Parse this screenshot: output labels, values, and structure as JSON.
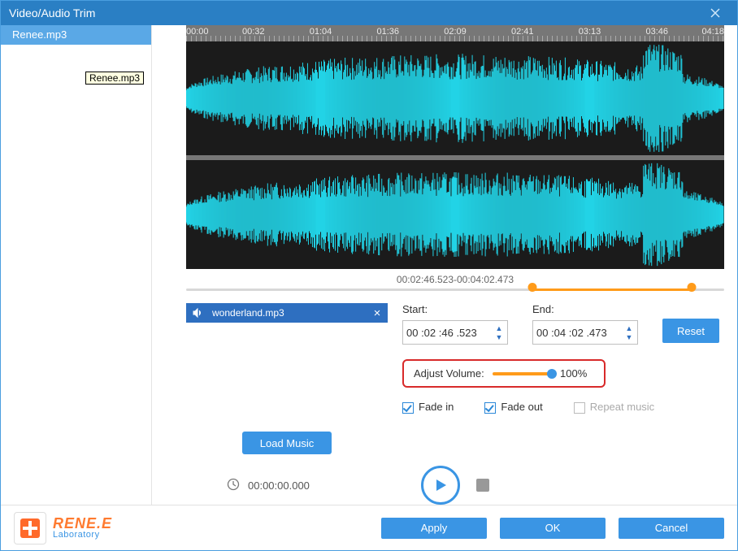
{
  "window": {
    "title": "Video/Audio Trim"
  },
  "sidebar": {
    "items": [
      {
        "label": "Renee.mp3"
      }
    ],
    "tooltip": "Renee.mp3"
  },
  "timeline": {
    "ticks": [
      "00:00",
      "00:32",
      "01:04",
      "01:36",
      "02:09",
      "02:41",
      "03:13",
      "03:46",
      "04:18"
    ]
  },
  "range": {
    "text": "00:02:46.523-00:04:02.473",
    "start_pct": 64.4,
    "end_pct": 93.9
  },
  "music": {
    "file": "wonderland.mp3"
  },
  "trim": {
    "start_label": "Start:",
    "end_label": "End:",
    "start_value": "00 :02 :46 .523",
    "end_value": "00 :04 :02 .473",
    "reset_label": "Reset"
  },
  "volume": {
    "label": "Adjust Volume:",
    "value_text": "100%"
  },
  "options": {
    "fade_in": {
      "label": "Fade in",
      "checked": true
    },
    "fade_out": {
      "label": "Fade out",
      "checked": true
    },
    "repeat": {
      "label": "Repeat music",
      "checked": false,
      "disabled": true
    }
  },
  "buttons": {
    "load_music": "Load Music",
    "apply": "Apply",
    "ok": "OK",
    "cancel": "Cancel"
  },
  "playback": {
    "time": "00:00:00.000"
  },
  "logo": {
    "line1": "RENE.E",
    "line2": "Laboratory"
  }
}
